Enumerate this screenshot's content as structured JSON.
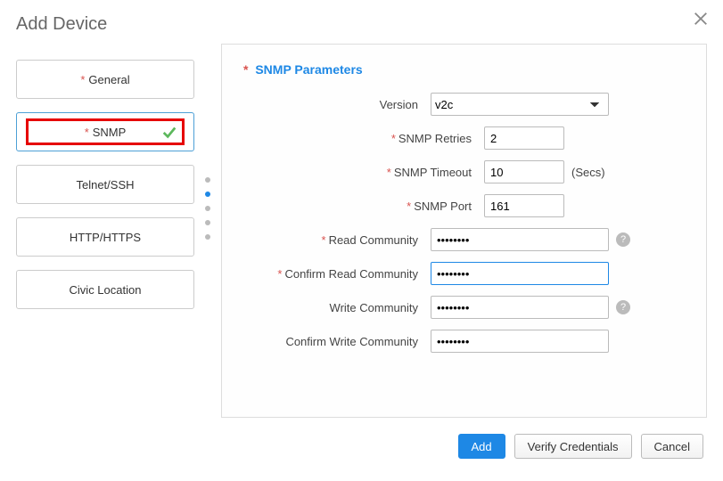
{
  "window": {
    "title": "Add Device"
  },
  "sidebar": {
    "items": [
      {
        "label": "General",
        "required": true
      },
      {
        "label": "SNMP",
        "required": true
      },
      {
        "label": "Telnet/SSH",
        "required": false
      },
      {
        "label": "HTTP/HTTPS",
        "required": false
      },
      {
        "label": "Civic Location",
        "required": false
      }
    ]
  },
  "main": {
    "section_title": "SNMP Parameters",
    "version_label": "Version",
    "version_value": "v2c",
    "retries_label": "SNMP Retries",
    "retries_value": "2",
    "timeout_label": "SNMP Timeout",
    "timeout_value": "10",
    "timeout_suffix": "(Secs)",
    "port_label": "SNMP Port",
    "port_value": "161",
    "read_comm_label": "Read Community",
    "read_comm_value": "••••••••",
    "confirm_read_label": "Confirm Read Community",
    "confirm_read_value": "••••••••",
    "write_comm_label": "Write Community",
    "write_comm_value": "••••••••",
    "confirm_write_label": "Confirm Write Community",
    "confirm_write_value": "••••••••"
  },
  "footer": {
    "add": "Add",
    "verify": "Verify Credentials",
    "cancel": "Cancel"
  },
  "glyphs": {
    "req": "*",
    "help": "?"
  }
}
